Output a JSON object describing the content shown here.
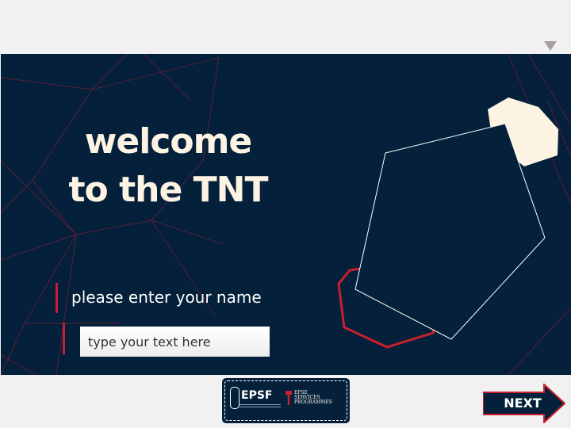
{
  "welcome": {
    "line1": "welcome",
    "line2": "to the TNT"
  },
  "name_prompt": {
    "label": "please enter your name",
    "input_placeholder": "type your text here",
    "input_value": ""
  },
  "footer": {
    "logo_primary": "EPSF",
    "logo_partner_lines": [
      "EPSE",
      "SERVICES",
      "PROGRAMMES"
    ],
    "next_label": "NEXT"
  },
  "colors": {
    "slide_background": "#04203a",
    "title_text": "#fdf3e3",
    "accent_red": "#c8202f",
    "cream_hexagon": "#fdf3e3",
    "page_background": "#f1f1f1"
  },
  "icons": {
    "menu_toggle": "triangle-down-icon",
    "next": "arrow-right-icon"
  }
}
